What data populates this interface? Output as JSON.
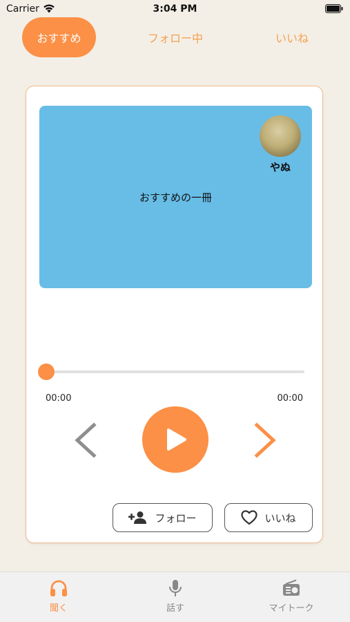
{
  "status": {
    "carrier": "Carrier",
    "time": "3:04 PM"
  },
  "top_tabs": [
    {
      "label": "おすすめ",
      "active": true
    },
    {
      "label": "フォロー中",
      "active": false
    },
    {
      "label": "いいね",
      "active": false
    }
  ],
  "card": {
    "cover_title": "おすすめの一冊",
    "author_name": "やぬ",
    "elapsed": "00:00",
    "duration": "00:00",
    "progress": 0,
    "follow_label": "フォロー",
    "like_label": "いいね"
  },
  "bottom_tabs": [
    {
      "label": "聞く",
      "icon": "headphones-icon",
      "active": true
    },
    {
      "label": "話す",
      "icon": "microphone-icon",
      "active": false
    },
    {
      "label": "マイトーク",
      "icon": "radio-icon",
      "active": false
    }
  ],
  "colors": {
    "accent": "#fb9046",
    "cover": "#68bde6",
    "background": "#f3efe6"
  }
}
